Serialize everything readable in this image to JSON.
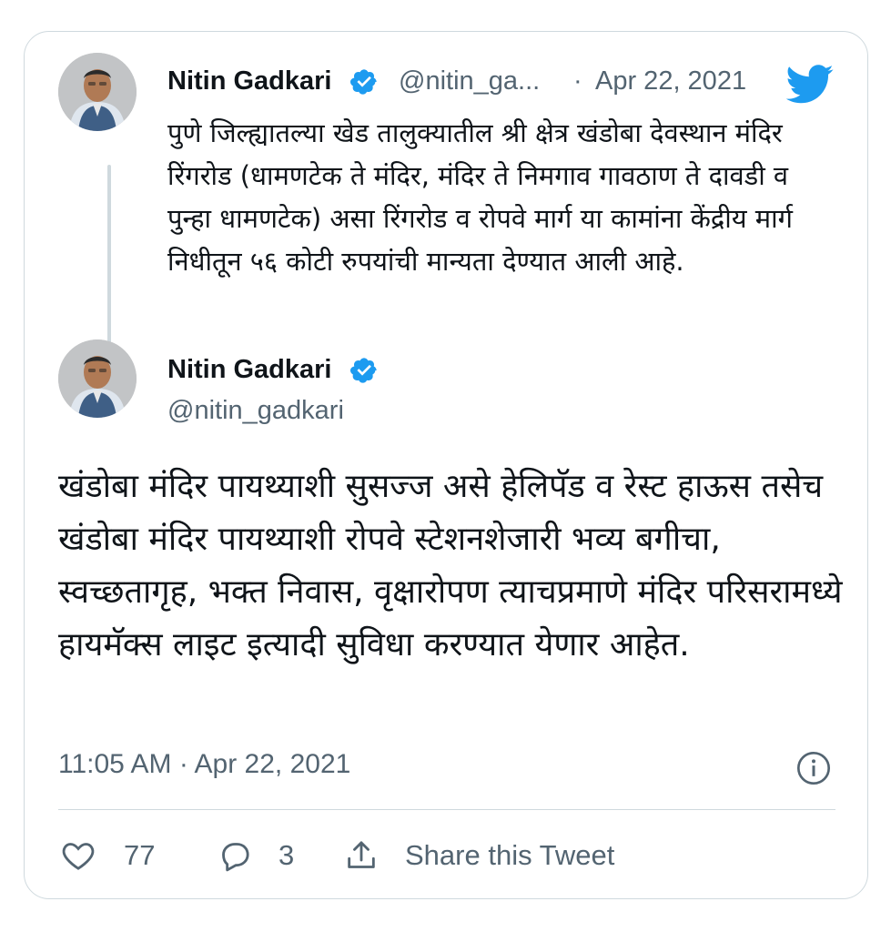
{
  "colors": {
    "twitter_blue": "#1d9bf0",
    "verified_blue": "#1d9bf0",
    "muted": "#536471",
    "border": "#cfd9de"
  },
  "reply_tweet": {
    "author_name": "Nitin Gadkari",
    "handle": "@nitin_ga...",
    "separator": "·",
    "date": "Apr 22, 2021",
    "body": "पुणे जिल्ह्यातल्या खेड तालुक्यातील श्री क्षेत्र खंडोबा देवस्थान मंदिर रिंगरोड (धामणटेक ते मंदिर, मंदिर ते निमगाव गावठाण ते दावडी व पुन्हा धामणटेक) असा रिंगरोड व रोपवे मार्ग या कामांना केंद्रीय मार्ग निधीतून ५६ कोटी रुपयांची मान्यता देण्यात आली आहे."
  },
  "main_tweet": {
    "author_name": "Nitin Gadkari",
    "handle": "@nitin_gadkari",
    "body": "खंडोबा मंदिर पायथ्याशी सुसज्ज असे हेलिपॅड व रेस्ट हाऊस तसेच खंडोबा मंदिर पायथ्याशी रोपवे स्टेशनशेजारी भव्य बगीचा, स्वच्छतागृह, भक्त निवास, वृक्षारोपण त्याचप्रमाणे मंदिर परिसरामध्ये हायमॅक्स लाइट इत्यादी सुविधा करण्यात येणार आहेत.",
    "timestamp": "11:05 AM · Apr 22, 2021"
  },
  "actions": {
    "likes": "77",
    "replies": "3",
    "share_label": "Share this Tweet"
  },
  "icons": [
    "twitter-bird-icon",
    "verified-badge-icon",
    "info-icon",
    "heart-icon",
    "reply-bubble-icon",
    "share-icon"
  ]
}
